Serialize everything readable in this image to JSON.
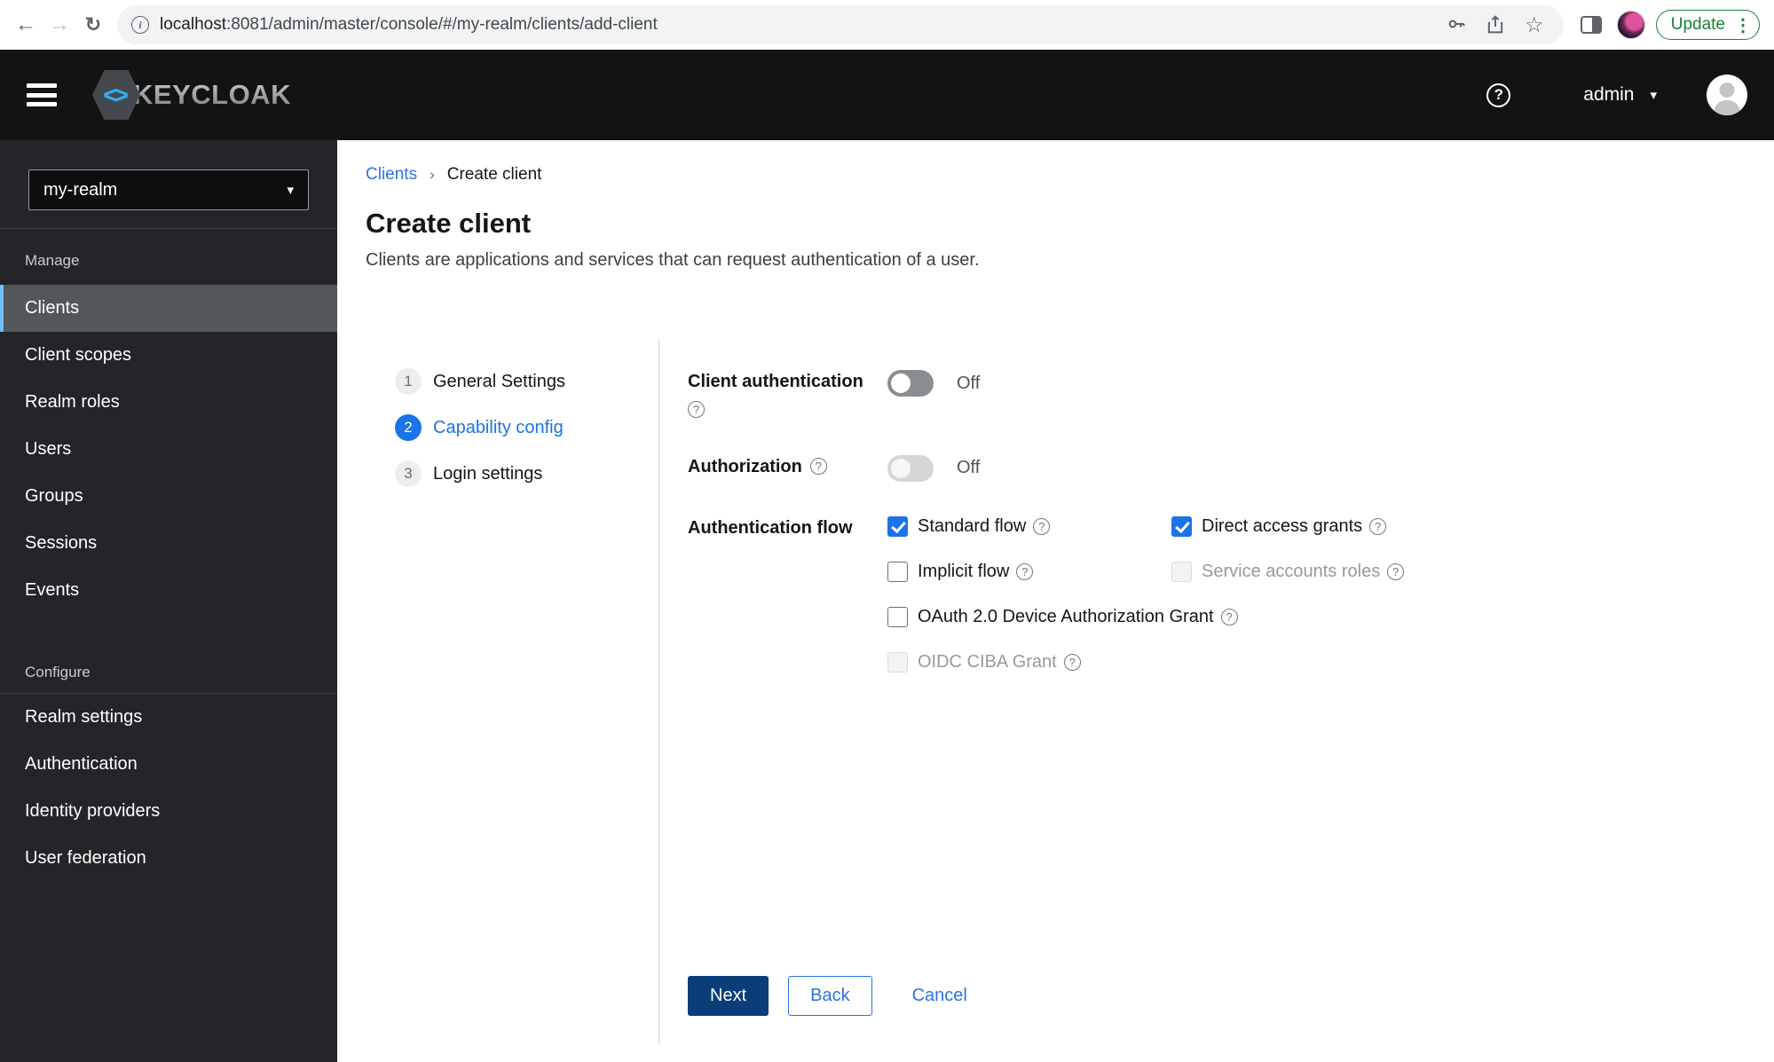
{
  "browser": {
    "url": {
      "host": "localhost",
      "rest": ":8081/admin/master/console/#/my-realm/clients/add-client"
    },
    "update_label": "Update"
  },
  "header": {
    "brand": "KEYCLOAK",
    "brand_glyphs": "<>",
    "help_glyph": "?",
    "username": "admin"
  },
  "sidebar": {
    "realm_selector": {
      "value": "my-realm"
    },
    "groups": [
      {
        "label": "Manage",
        "items": [
          {
            "label": "Clients",
            "active": true
          },
          {
            "label": "Client scopes",
            "active": false
          },
          {
            "label": "Realm roles",
            "active": false
          },
          {
            "label": "Users",
            "active": false
          },
          {
            "label": "Groups",
            "active": false
          },
          {
            "label": "Sessions",
            "active": false
          },
          {
            "label": "Events",
            "active": false
          }
        ]
      },
      {
        "label": "Configure",
        "items": [
          {
            "label": "Realm settings",
            "active": false
          },
          {
            "label": "Authentication",
            "active": false
          },
          {
            "label": "Identity providers",
            "active": false
          },
          {
            "label": "User federation",
            "active": false
          }
        ]
      }
    ]
  },
  "breadcrumb": {
    "parent": "Clients",
    "separator": "›",
    "current": "Create client"
  },
  "page": {
    "title": "Create client",
    "subtitle": "Clients are applications and services that can request authentication of a user."
  },
  "wizard": {
    "steps": [
      {
        "num": "1",
        "label": "General Settings",
        "active": false
      },
      {
        "num": "2",
        "label": "Capability config",
        "active": true
      },
      {
        "num": "3",
        "label": "Login settings",
        "active": false
      }
    ]
  },
  "form": {
    "fields": {
      "client_authentication": {
        "label": "Client authentication",
        "state": "Off"
      },
      "authorization": {
        "label": "Authorization",
        "state": "Off"
      },
      "authentication_flow": {
        "label": "Authentication flow"
      }
    },
    "checkboxes": [
      {
        "label": "Standard flow",
        "checked": true,
        "disabled": false
      },
      {
        "label": "Direct access grants",
        "checked": true,
        "disabled": false
      },
      {
        "label": "Implicit flow",
        "checked": false,
        "disabled": false
      },
      {
        "label": "Service accounts roles",
        "checked": false,
        "disabled": true
      },
      {
        "label": "OAuth 2.0 Device Authorization Grant",
        "checked": false,
        "disabled": false
      },
      {
        "label": "OIDC CIBA Grant",
        "checked": false,
        "disabled": true
      }
    ],
    "actions": {
      "next": "Next",
      "back": "Back",
      "cancel": "Cancel"
    }
  },
  "icons": {
    "back": "←",
    "forward": "→",
    "reload": "↻",
    "star": "☆",
    "caret_down": "▾",
    "dots_vertical": "⋮",
    "help": "?"
  },
  "colors": {
    "accent": "#1a73e8",
    "link": "#2b73e2",
    "primary_button": "#0b3d78",
    "nav_indicator": "#73bcf7",
    "update_green": "#188038"
  }
}
